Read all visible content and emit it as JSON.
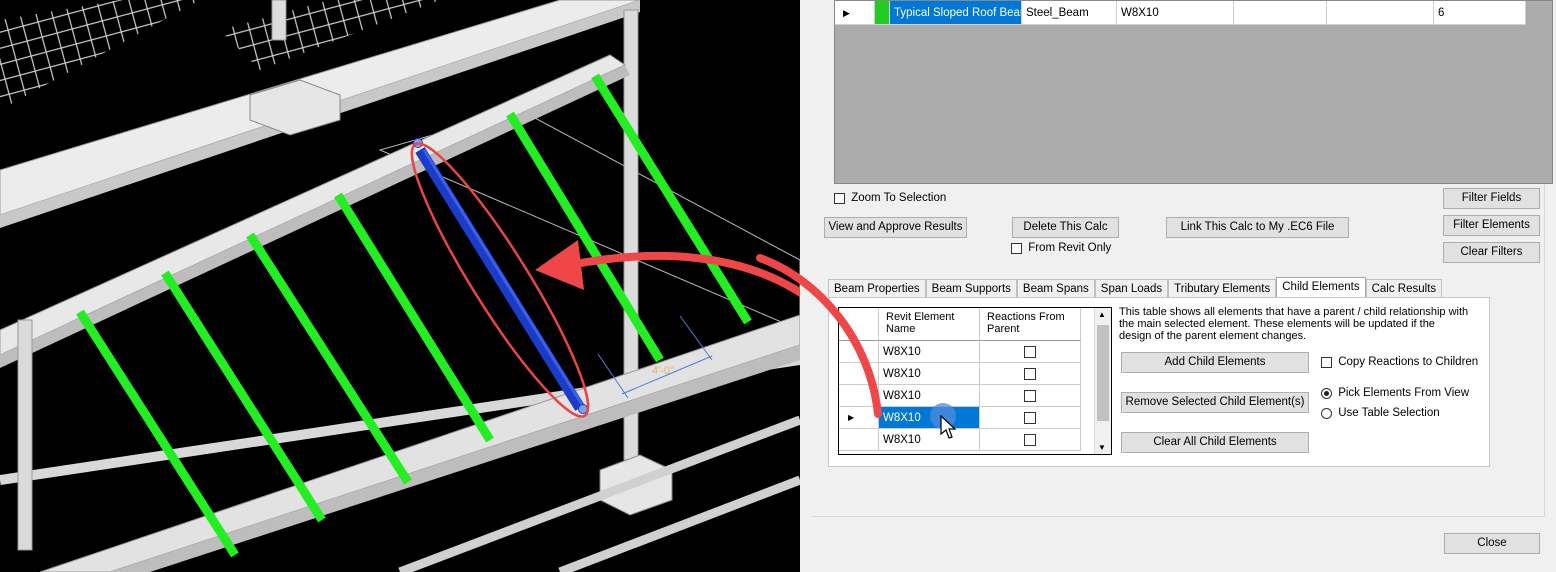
{
  "results_grid": {
    "row": {
      "name": "Typical Sloped Roof Beam",
      "material": "Steel_Beam",
      "size": "W8X10",
      "col5": "",
      "col6": "",
      "count": "6",
      "status_color": "#22cc22",
      "highlight_color": "#0078d7"
    }
  },
  "options": {
    "zoom_to_selection": "Zoom To Selection",
    "from_revit_only": "From Revit Only"
  },
  "buttons": {
    "view_approve": "View and Approve Results",
    "delete_calc": "Delete This Calc",
    "link_calc": "Link This Calc to My .EC6 File",
    "filter_fields": "Filter Fields",
    "filter_elements": "Filter Elements",
    "clear_filters": "Clear Filters",
    "close": "Close"
  },
  "tabs": [
    {
      "label": "Beam Properties"
    },
    {
      "label": "Beam Supports"
    },
    {
      "label": "Beam Spans"
    },
    {
      "label": "Span Loads"
    },
    {
      "label": "Tributary Elements"
    },
    {
      "label": "Child Elements"
    },
    {
      "label": "Calc Results"
    }
  ],
  "child_elements": {
    "columns": [
      "Revit Element Name",
      "Reactions From Parent"
    ],
    "rows": [
      {
        "name": "W8X10",
        "reactions": false
      },
      {
        "name": "W8X10",
        "reactions": false
      },
      {
        "name": "W8X10",
        "reactions": false
      },
      {
        "name": "W8X10",
        "reactions": false
      },
      {
        "name": "W8X10",
        "reactions": false
      }
    ],
    "selected_row": 3,
    "description": "This table shows all elements that have a parent / child relationship with the main selected element.  These elements will be updated if the design of the parent element changes.",
    "add_button": "Add Child Elements",
    "remove_button": "Remove Selected Child Element(s)",
    "clear_button": "Clear All Child Elements",
    "copy_reactions": "Copy Reactions to Children",
    "pick_from_view": "Pick Elements From View",
    "use_table_selection": "Use Table Selection",
    "pick_mode": "Pick Elements From View"
  },
  "viewport": {
    "background": "#000000",
    "child_beam_color": "#22ee22",
    "selected_beam_color": "#1a3cc8",
    "callout_color": "#e84545",
    "dimension_label": "4'-0\""
  }
}
